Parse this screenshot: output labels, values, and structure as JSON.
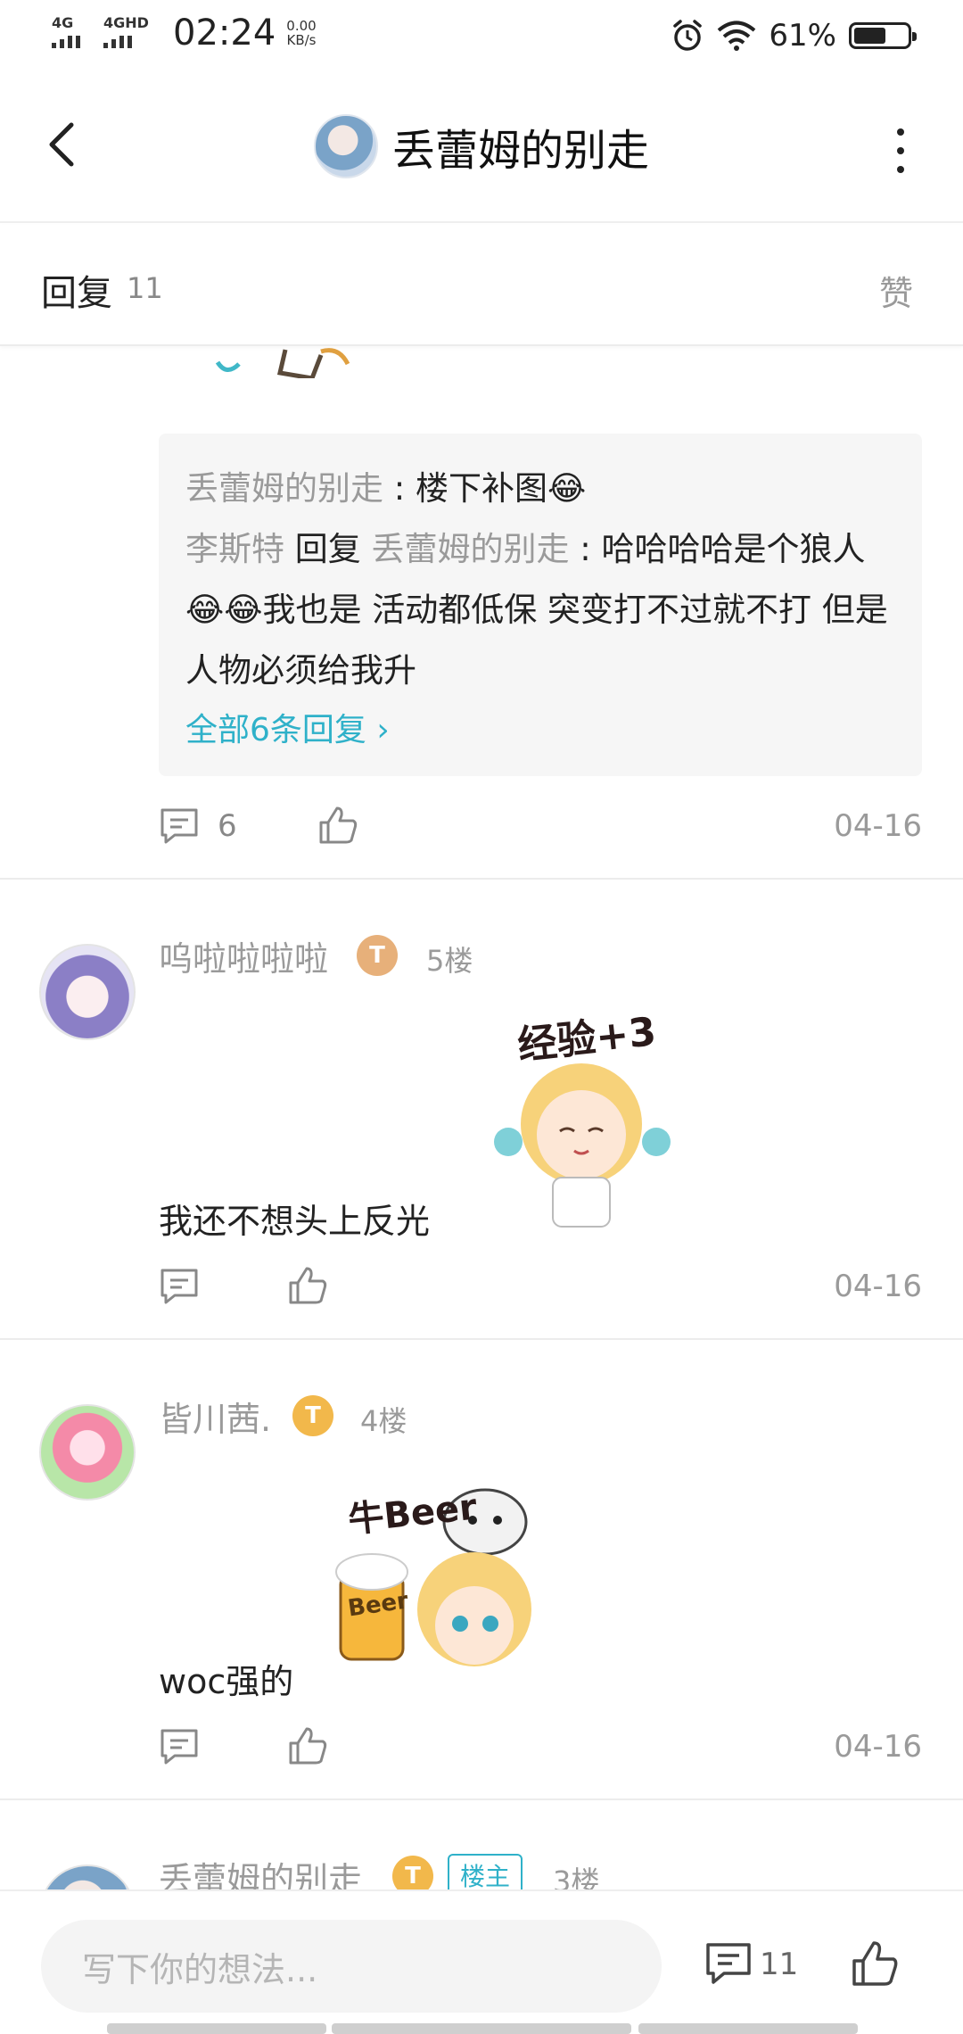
{
  "status_bar": {
    "signal1": "4G",
    "signal2": "4GHD",
    "time": "02:24",
    "speed_value": "0.00",
    "speed_unit": "KB/s",
    "battery": "61%",
    "battery_level": 0.61
  },
  "header": {
    "title": "丢蕾姆的别走"
  },
  "reply_header": {
    "title": "回复",
    "count": "11",
    "like_label": "赞"
  },
  "comment_thread": {
    "replies": [
      {
        "name": "丢蕾姆的别走",
        "sep": " : ",
        "text": "楼下补图😂"
      },
      {
        "name": "李斯特",
        "reply_word": " 回复 ",
        "target": "丢蕾姆的别走",
        "sep": " : ",
        "text": "哈哈哈哈是个狼人😂😂我也是 活动都低保 突变打不过就不打 但是人物必须给我升"
      }
    ],
    "all_replies_link": "全部6条回复 ›",
    "comment_count": "6",
    "date": "04-16"
  },
  "posts": [
    {
      "username": "呜啦啦啦啦",
      "level": "T",
      "floor": "5楼",
      "text": "我还不想头上反光",
      "sticker_caption": "经验+3",
      "date": "04-16"
    },
    {
      "username": "皆川茜.",
      "level": "T",
      "floor": "4楼",
      "text": "woc强的",
      "sticker_caption": "牛Beer",
      "sticker_mug_text": "Beer",
      "date": "04-16"
    },
    {
      "username": "丢蕾姆的别走",
      "level": "T",
      "owner_tag": "楼主",
      "floor": "3楼"
    }
  ],
  "bottom_bar": {
    "placeholder": "写下你的想法...",
    "comment_count": "11"
  },
  "colors": {
    "accent": "#2fb1c9",
    "muted": "#9a9a9a",
    "level_badge": "#f2b84b"
  }
}
